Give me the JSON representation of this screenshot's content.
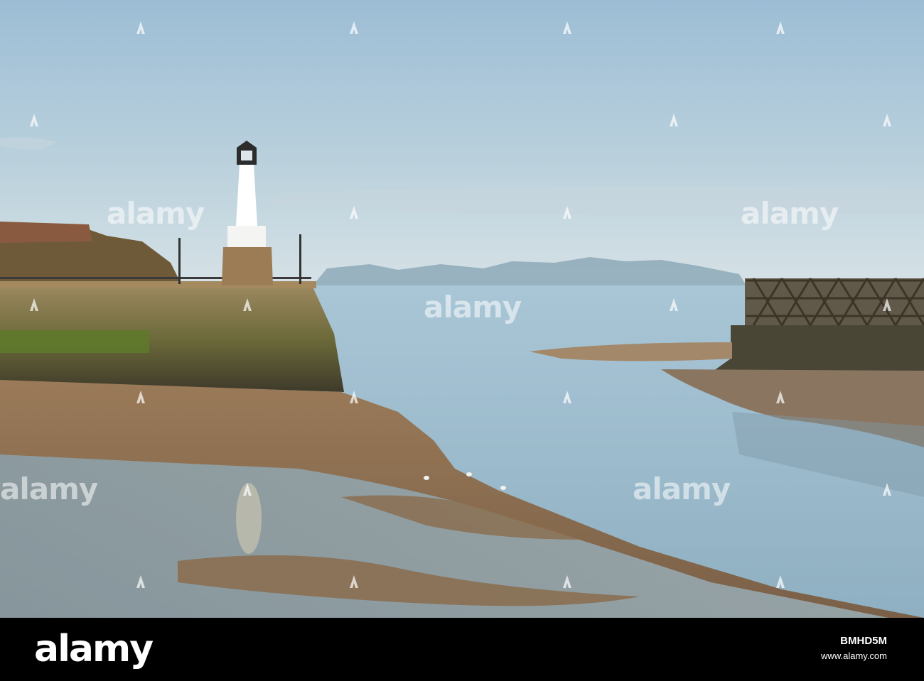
{
  "photo": {
    "scene": "harbour",
    "colors": {
      "sky_top": "#9ebfd6",
      "sky_bottom": "#d3e1e6",
      "sea": "#a8c4d2",
      "sand": "#8a6a4a",
      "wall": "#8a7850",
      "lighthouse": "#ffffff"
    }
  },
  "watermark": {
    "brand": "alamy"
  },
  "footer": {
    "logo": "alamy",
    "image_id": "BMHD5M",
    "url": "www.alamy.com"
  }
}
